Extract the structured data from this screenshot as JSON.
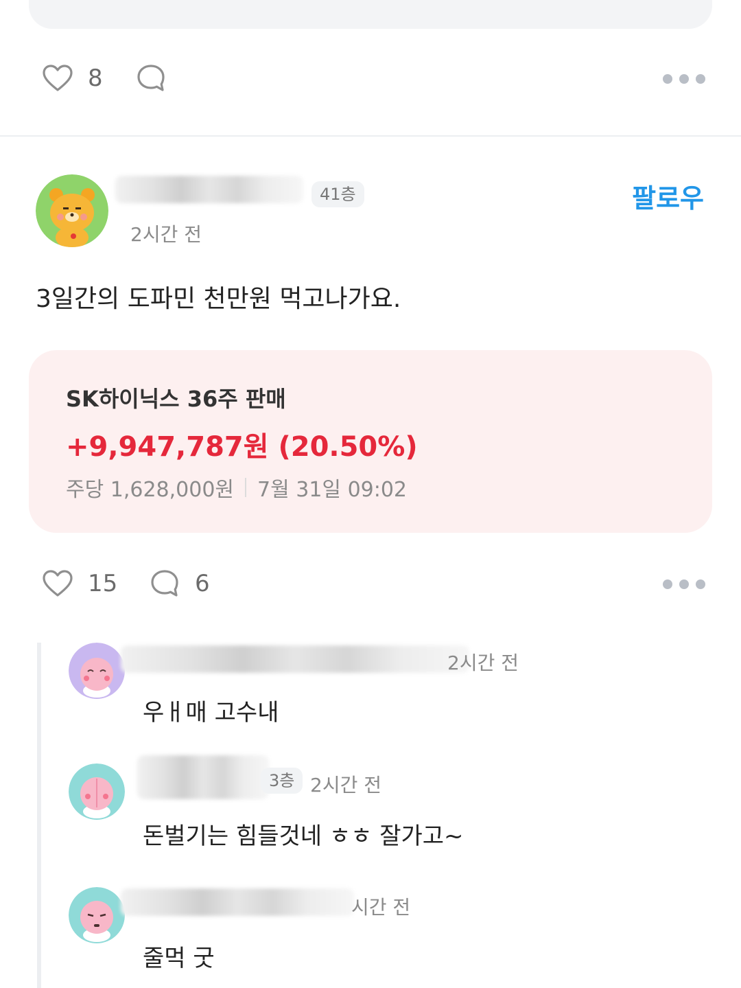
{
  "prev_post": {
    "like_count": "8",
    "comment_count": ""
  },
  "post": {
    "author_name": "",
    "floor": "41층",
    "time": "2시간 전",
    "follow_label": "팔로우",
    "text": "3일간의 도파민 천만원 먹고나가요.",
    "trade": {
      "title": "SK하이닉스 36주 판매",
      "gain": "+9,947,787원 (20.50%)",
      "price": "주당 1,628,000원",
      "datetime": "7월 31일 09:02"
    },
    "like_count": "15",
    "comment_count": "6"
  },
  "comments": [
    {
      "author": "",
      "floor": "",
      "time": "2시간 전",
      "text": "우ㅐ매 고수내"
    },
    {
      "author": "",
      "floor": "3층",
      "time": "2시간 전",
      "text": "돈벌기는 힘들것네 ㅎㅎ 잘가고~"
    },
    {
      "author": "",
      "floor": "",
      "time": "시간 전",
      "text": "줄먹 굿"
    }
  ],
  "icons": {
    "like": "heart-outline-icon",
    "comment": "speech-bubble-icon",
    "more": "more-horizontal-icon"
  },
  "colors": {
    "follow": "#2196e8",
    "gain": "#e5283b",
    "trade_card_bg": "#fdf0f0"
  }
}
